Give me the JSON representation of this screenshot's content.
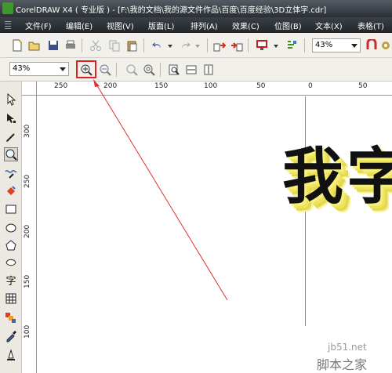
{
  "titlebar": {
    "title": "CorelDRAW X4 ( 专业版 ) - [F:\\我的文档\\我的源文件作品\\百度\\百度经验\\3D立体字.cdr]"
  },
  "menubar": {
    "items": [
      "文件(F)",
      "编辑(E)",
      "视图(V)",
      "版面(L)",
      "排列(A)",
      "效果(C)",
      "位图(B)",
      "文本(X)",
      "表格(T)"
    ]
  },
  "toolbar": {
    "zoom_value": "43%"
  },
  "property_bar": {
    "zoom_value": "43%"
  },
  "ruler": {
    "horizontal_labels": [
      "250",
      "200",
      "150",
      "100",
      "50",
      "0",
      "50"
    ],
    "vertical_labels": [
      "300",
      "250",
      "200",
      "150",
      "100"
    ]
  },
  "toolbox": {
    "text_tool_glyph": "字"
  },
  "canvas": {
    "artwork_text": "我字"
  },
  "watermark": {
    "site": "jb51.net",
    "name": "脚本之家"
  },
  "colors": {
    "highlight": "#e02020",
    "arrow": "#e03030",
    "menubar": "#2d3238"
  }
}
